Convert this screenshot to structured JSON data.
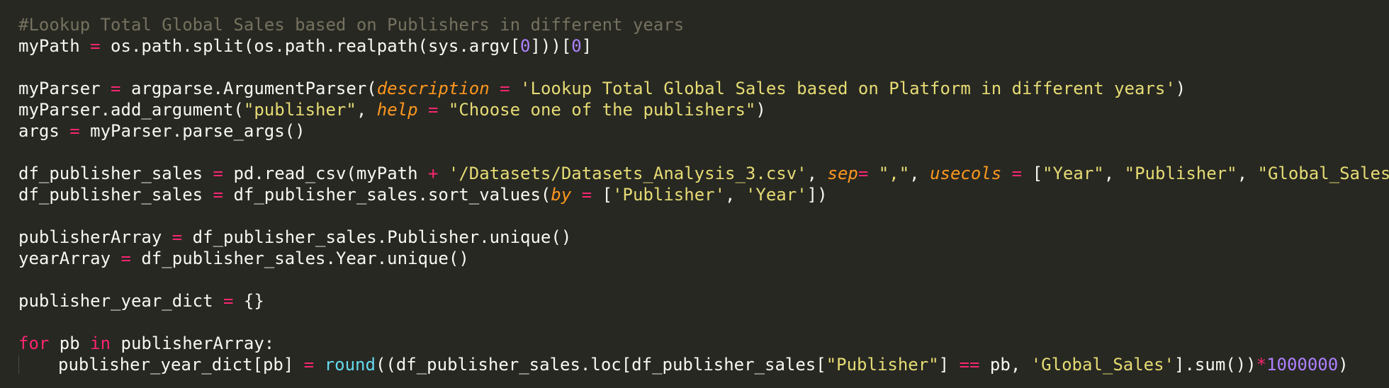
{
  "editor": {
    "theme": {
      "background": "#272822",
      "text": "#f8f8f2",
      "comment": "#75715e",
      "keyword": "#f92672",
      "string": "#e6db74",
      "number": "#ae81ff",
      "param": "#fd971f",
      "builtin": "#66d9ef"
    },
    "lines": [
      {
        "indent": false,
        "tokens": [
          {
            "t": "comment",
            "v": "#Lookup Total Global Sales based on Publishers in different years"
          }
        ]
      },
      {
        "indent": false,
        "tokens": [
          {
            "t": "ident",
            "v": "myPath "
          },
          {
            "t": "operator",
            "v": "="
          },
          {
            "t": "ident",
            "v": " os.path.split(os.path.realpath(sys.argv["
          },
          {
            "t": "number",
            "v": "0"
          },
          {
            "t": "ident",
            "v": "]))["
          },
          {
            "t": "number",
            "v": "0"
          },
          {
            "t": "ident",
            "v": "]"
          }
        ]
      },
      {
        "indent": false,
        "tokens": []
      },
      {
        "indent": false,
        "tokens": [
          {
            "t": "ident",
            "v": "myParser "
          },
          {
            "t": "operator",
            "v": "="
          },
          {
            "t": "ident",
            "v": " argparse.ArgumentParser("
          },
          {
            "t": "param",
            "v": "description"
          },
          {
            "t": "ident",
            "v": " "
          },
          {
            "t": "operator",
            "v": "="
          },
          {
            "t": "ident",
            "v": " "
          },
          {
            "t": "string",
            "v": "'Lookup Total Global Sales based on Platform in different years'"
          },
          {
            "t": "ident",
            "v": ")"
          }
        ]
      },
      {
        "indent": false,
        "tokens": [
          {
            "t": "ident",
            "v": "myParser.add_argument("
          },
          {
            "t": "string",
            "v": "\"publisher\""
          },
          {
            "t": "ident",
            "v": ", "
          },
          {
            "t": "param",
            "v": "help"
          },
          {
            "t": "ident",
            "v": " "
          },
          {
            "t": "operator",
            "v": "="
          },
          {
            "t": "ident",
            "v": " "
          },
          {
            "t": "string",
            "v": "\"Choose one of the publishers\""
          },
          {
            "t": "ident",
            "v": ")"
          }
        ]
      },
      {
        "indent": false,
        "tokens": [
          {
            "t": "ident",
            "v": "args "
          },
          {
            "t": "operator",
            "v": "="
          },
          {
            "t": "ident",
            "v": " myParser.parse_args()"
          }
        ]
      },
      {
        "indent": false,
        "tokens": []
      },
      {
        "indent": false,
        "tokens": [
          {
            "t": "ident",
            "v": "df_publisher_sales "
          },
          {
            "t": "operator",
            "v": "="
          },
          {
            "t": "ident",
            "v": " pd.read_csv(myPath "
          },
          {
            "t": "operator",
            "v": "+"
          },
          {
            "t": "ident",
            "v": " "
          },
          {
            "t": "string",
            "v": "'/Datasets/Datasets_Analysis_3.csv'"
          },
          {
            "t": "ident",
            "v": ", "
          },
          {
            "t": "param",
            "v": "sep"
          },
          {
            "t": "operator",
            "v": "="
          },
          {
            "t": "ident",
            "v": " "
          },
          {
            "t": "string",
            "v": "\",\""
          },
          {
            "t": "ident",
            "v": ", "
          },
          {
            "t": "param",
            "v": "usecols"
          },
          {
            "t": "ident",
            "v": " "
          },
          {
            "t": "operator",
            "v": "="
          },
          {
            "t": "ident",
            "v": " ["
          },
          {
            "t": "string",
            "v": "\"Year\""
          },
          {
            "t": "ident",
            "v": ", "
          },
          {
            "t": "string",
            "v": "\"Publisher\""
          },
          {
            "t": "ident",
            "v": ", "
          },
          {
            "t": "string",
            "v": "\"Global_Sales\""
          },
          {
            "t": "ident",
            "v": "])"
          }
        ]
      },
      {
        "indent": false,
        "tokens": [
          {
            "t": "ident",
            "v": "df_publisher_sales "
          },
          {
            "t": "operator",
            "v": "="
          },
          {
            "t": "ident",
            "v": " df_publisher_sales.sort_values("
          },
          {
            "t": "param",
            "v": "by"
          },
          {
            "t": "ident",
            "v": " "
          },
          {
            "t": "operator",
            "v": "="
          },
          {
            "t": "ident",
            "v": " ["
          },
          {
            "t": "string",
            "v": "'Publisher'"
          },
          {
            "t": "ident",
            "v": ", "
          },
          {
            "t": "string",
            "v": "'Year'"
          },
          {
            "t": "ident",
            "v": "])"
          }
        ]
      },
      {
        "indent": false,
        "tokens": []
      },
      {
        "indent": false,
        "tokens": [
          {
            "t": "ident",
            "v": "publisherArray "
          },
          {
            "t": "operator",
            "v": "="
          },
          {
            "t": "ident",
            "v": " df_publisher_sales.Publisher.unique()"
          }
        ]
      },
      {
        "indent": false,
        "tokens": [
          {
            "t": "ident",
            "v": "yearArray "
          },
          {
            "t": "operator",
            "v": "="
          },
          {
            "t": "ident",
            "v": " df_publisher_sales.Year.unique()"
          }
        ]
      },
      {
        "indent": false,
        "tokens": []
      },
      {
        "indent": false,
        "tokens": [
          {
            "t": "ident",
            "v": "publisher_year_dict "
          },
          {
            "t": "operator",
            "v": "="
          },
          {
            "t": "ident",
            "v": " {}"
          }
        ]
      },
      {
        "indent": false,
        "tokens": []
      },
      {
        "indent": false,
        "tokens": [
          {
            "t": "keyword",
            "v": "for"
          },
          {
            "t": "ident",
            "v": " pb "
          },
          {
            "t": "keyword",
            "v": "in"
          },
          {
            "t": "ident",
            "v": " publisherArray:"
          }
        ]
      },
      {
        "indent": true,
        "tokens": [
          {
            "t": "ident",
            "v": "publisher_year_dict[pb] "
          },
          {
            "t": "operator",
            "v": "="
          },
          {
            "t": "ident",
            "v": " "
          },
          {
            "t": "builtin",
            "v": "round"
          },
          {
            "t": "ident",
            "v": "((df_publisher_sales.loc[df_publisher_sales["
          },
          {
            "t": "string",
            "v": "\"Publisher\""
          },
          {
            "t": "ident",
            "v": "] "
          },
          {
            "t": "operator",
            "v": "=="
          },
          {
            "t": "ident",
            "v": " pb, "
          },
          {
            "t": "string",
            "v": "'Global_Sales'"
          },
          {
            "t": "ident",
            "v": "].sum())"
          },
          {
            "t": "operator",
            "v": "*"
          },
          {
            "t": "number",
            "v": "1000000"
          },
          {
            "t": "ident",
            "v": ")"
          }
        ]
      }
    ]
  }
}
